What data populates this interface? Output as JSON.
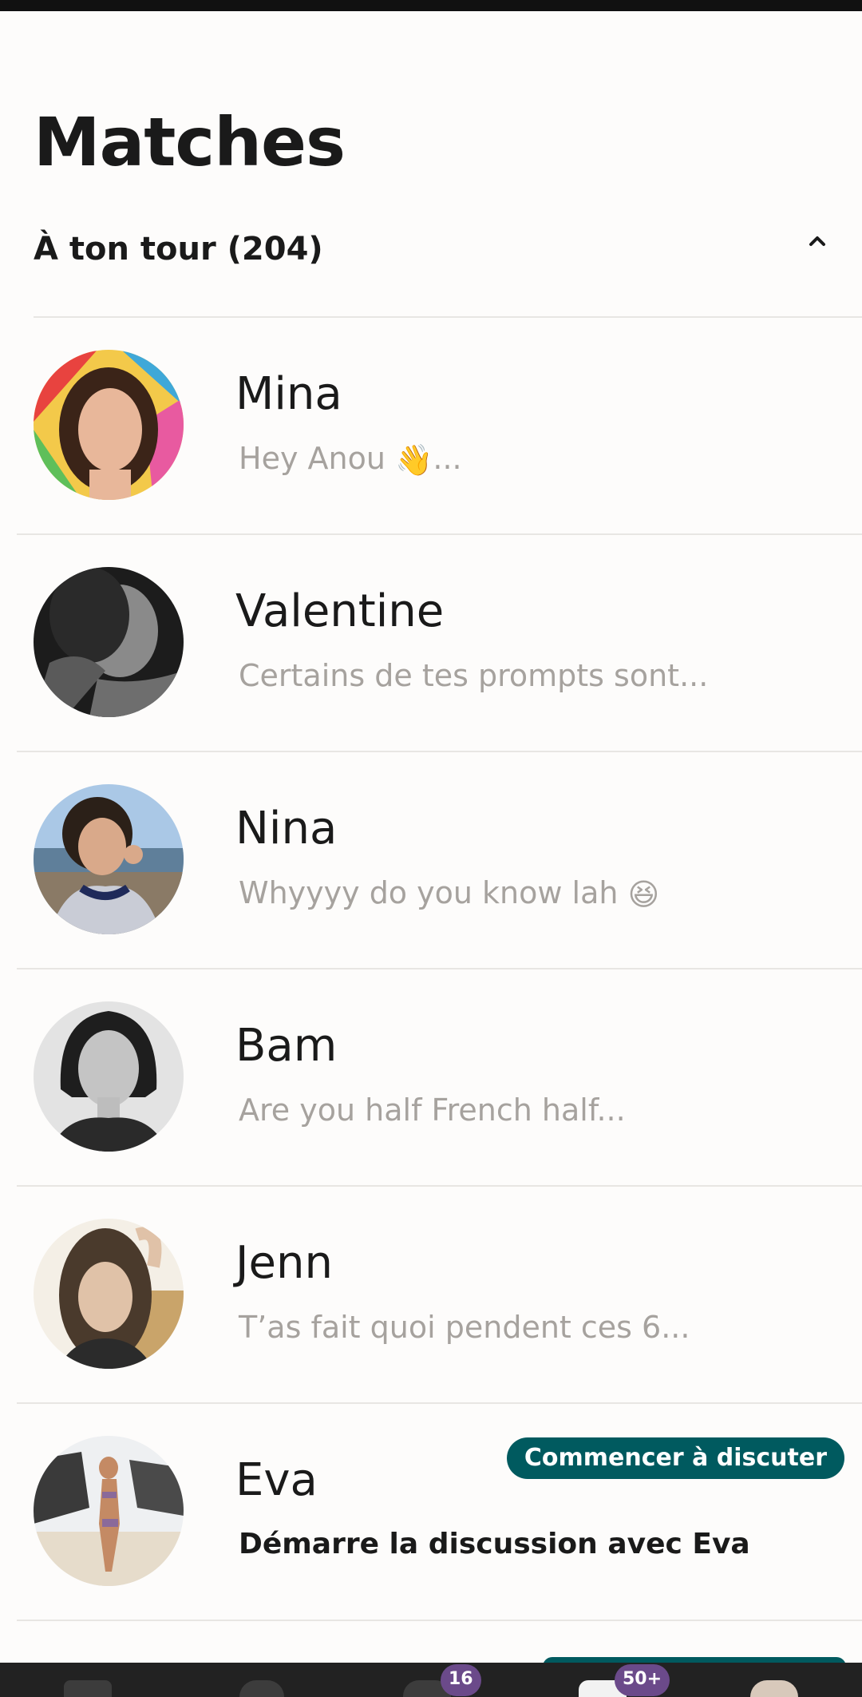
{
  "header": {
    "title": "Matches"
  },
  "section": {
    "title": "À ton tour (204)",
    "collapse_icon": "chevron-up-icon"
  },
  "matches": [
    {
      "name": "Mina",
      "preview": "Hey Anou",
      "preview_emoji": "👋",
      "preview_suffix": "...",
      "avatar": "photo-colorful-umbrella"
    },
    {
      "name": "Valentine",
      "preview": "Certains de tes prompts sont...",
      "avatar": "photo-black-and-white"
    },
    {
      "name": "Nina",
      "preview": "Whyyyy do you know lah",
      "preview_emoji": "😆",
      "preview_suffix": "",
      "avatar": "photo-seaside"
    },
    {
      "name": "Bam",
      "preview": "Are you half French half...",
      "avatar": "photo-black-and-white-bob"
    },
    {
      "name": "Jenn",
      "preview": "T’as fait quoi pendent ces 6...",
      "avatar": "photo-indoor"
    },
    {
      "name": "Eva",
      "preview": "Démarre la discussion avec Eva",
      "avatar": "photo-beach",
      "badge": "Commencer à discuter"
    }
  ],
  "bottom_nav": {
    "badges": [
      "16",
      "50+"
    ]
  },
  "colors": {
    "accent": "#005a5f",
    "nav_badge": "#6b4a8a",
    "muted_text": "#a6a29e"
  }
}
